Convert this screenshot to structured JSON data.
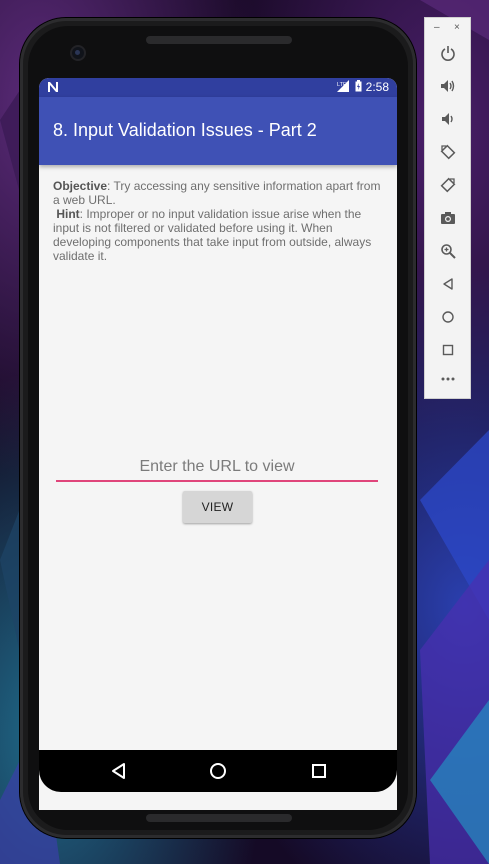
{
  "status_bar": {
    "network": "LTE",
    "time": "2:58"
  },
  "app_bar": {
    "title": "8. Input Validation Issues - Part 2"
  },
  "content": {
    "objective_label": "Objective",
    "objective_text": ": Try accessing any sensitive information apart from a web URL.",
    "hint_label": "Hint",
    "hint_text": ": Improper or no input validation issue arise when the input is not filtered or validated before using it. When developing components that take input from outside, always validate it."
  },
  "url_input": {
    "placeholder": "Enter the URL to view",
    "value": ""
  },
  "view_button": {
    "label": "VIEW"
  },
  "emulator_toolbar": {
    "minimize": "–",
    "close": "×",
    "buttons": [
      "power-icon",
      "volume-up-icon",
      "volume-down-icon",
      "rotate-left-icon",
      "rotate-right-icon",
      "camera-icon",
      "zoom-icon",
      "back-icon",
      "home-icon",
      "overview-icon",
      "more-icon"
    ]
  },
  "colors": {
    "status_bar": "#303f9f",
    "app_bar": "#3f51b5",
    "input_underline": "#e0457b",
    "button_bg": "#d6d6d6"
  }
}
